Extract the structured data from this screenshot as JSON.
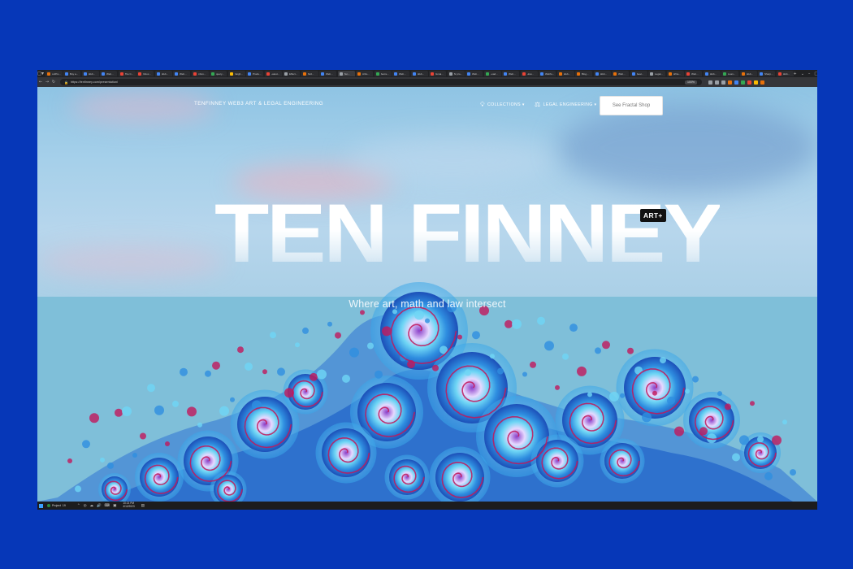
{
  "browser": {
    "window_controls": [
      "◻",
      "▾"
    ],
    "tabs": [
      {
        "title": "outPro...",
        "color": "#e8710a"
      },
      {
        "title": "Buy a...",
        "color": "#4285f4"
      },
      {
        "title": "Web...",
        "color": "#4285f4"
      },
      {
        "title": "Web...",
        "color": "#4285f4"
      },
      {
        "title": "The C...",
        "color": "#ea4335"
      },
      {
        "title": "Inbox...",
        "color": "#ea4335"
      },
      {
        "title": "Web...",
        "color": "#4285f4"
      },
      {
        "title": "Web...",
        "color": "#4285f4"
      },
      {
        "title": "Inbox...",
        "color": "#ea4335"
      },
      {
        "title": "query...",
        "color": "#34a853"
      },
      {
        "title": "Neigh...",
        "color": "#fbbc04"
      },
      {
        "title": "Produ...",
        "color": "#4285f4"
      },
      {
        "title": "Latest...",
        "color": "#ea4335"
      },
      {
        "title": "Effect...",
        "color": "#9aa0a6"
      },
      {
        "title": "Add...",
        "color": "#e8710a"
      },
      {
        "title": "Web...",
        "color": "#4285f4"
      },
      {
        "title": "Ten...",
        "color": "#9aa0a6",
        "active": true
      },
      {
        "title": "Arbo...",
        "color": "#e8710a"
      },
      {
        "title": "Secre...",
        "color": "#34a853"
      },
      {
        "title": "Web...",
        "color": "#4285f4"
      },
      {
        "title": "Web...",
        "color": "#4285f4"
      },
      {
        "title": "Gmai...",
        "color": "#ea4335"
      },
      {
        "title": "AI pro...",
        "color": "#9aa0a6"
      },
      {
        "title": "Web...",
        "color": "#4285f4"
      },
      {
        "title": "Load...",
        "color": "#34a853"
      },
      {
        "title": "Web...",
        "color": "#4285f4"
      },
      {
        "title": "How...",
        "color": "#ea4335"
      },
      {
        "title": "Webfo...",
        "color": "#4285f4"
      },
      {
        "title": "Web...",
        "color": "#e8710a"
      },
      {
        "title": "Blog...",
        "color": "#e8710a"
      },
      {
        "title": "Web...",
        "color": "#4285f4"
      },
      {
        "title": "Web...",
        "color": "#e8710a"
      },
      {
        "title": "Sear...",
        "color": "#4285f4"
      },
      {
        "title": "Legal...",
        "color": "#9aa0a6"
      },
      {
        "title": "Write...",
        "color": "#e8710a"
      },
      {
        "title": "Web...",
        "color": "#ea4335"
      },
      {
        "title": "Web...",
        "color": "#4285f4"
      },
      {
        "title": "Loan...",
        "color": "#34a853"
      },
      {
        "title": "Web...",
        "color": "#e8710a"
      },
      {
        "title": "Sharp...",
        "color": "#4285f4"
      },
      {
        "title": "Web...",
        "color": "#ea4335"
      }
    ],
    "tab_actions": [
      "+",
      "⌄",
      "–",
      "□",
      "×"
    ],
    "nav": {
      "back": "←",
      "forward": "→",
      "reload": "↻"
    },
    "url": "https://tenfinney.com/presentation/",
    "zoom": "100%",
    "extension_colors": [
      "#9aa0a6",
      "#9aa0a6",
      "#9aa0a6",
      "#e8710a",
      "#4285f4",
      "#34a853",
      "#ea4335",
      "#fbbc04",
      "#e8710a"
    ]
  },
  "site": {
    "brand": "TENFINNEY WEB3 ART & LEGAL ENGINEERING",
    "menu": [
      {
        "label": "COLLECTIONS ▾",
        "icon": "lightbulb-icon"
      },
      {
        "label": "LEGAL ENGINEERING ▾",
        "icon": "scale-icon"
      }
    ],
    "cta": "See Fractal Shop",
    "hero_title": "TEN FINNEY",
    "badge": "ART+",
    "tagline": "Where art, math and law intersect"
  },
  "taskbar": {
    "app_label": "Project",
    "app_extra": "19",
    "tray_icons": [
      "⌃",
      "◎",
      "☁",
      "🔊",
      "⌨",
      "▣"
    ],
    "time": "10:21 PM",
    "date": "4/12/2023",
    "end_icon": "▤"
  },
  "colors": {
    "background": "#0637b8",
    "fractal_deep": "#1c4fb8",
    "fractal_mid": "#2f8ee0",
    "fractal_light": "#6fd6f5",
    "fractal_accent": "#c2185b",
    "fractal_core": "#8b3fc9"
  }
}
